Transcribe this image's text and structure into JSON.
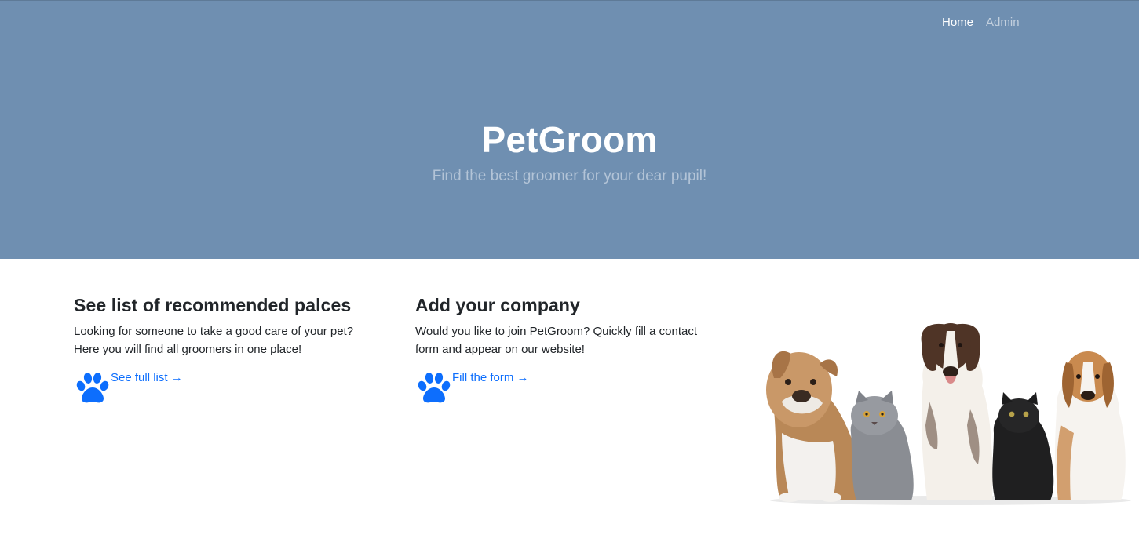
{
  "nav": {
    "items": [
      {
        "label": "Home",
        "active": true
      },
      {
        "label": "Admin",
        "active": false
      }
    ]
  },
  "hero": {
    "title": "PetGroom",
    "subtitle": "Find the best groomer for your dear pupil!"
  },
  "cards": [
    {
      "heading": "See list of recommended palces",
      "text": "Looking for someone to take a good care of your pet? Here you will find all groomers in one place!",
      "link": "See full list →"
    },
    {
      "heading": "Add your company",
      "text": "Would you like to join PetGroom? Quickly fill a contact form and appear on our website!",
      "link": "Fill the form →"
    }
  ],
  "icons": [
    "paw-icon"
  ],
  "colors": {
    "hero_bg": "#6f8fb1",
    "link": "#0d6efd",
    "text": "#212529"
  }
}
